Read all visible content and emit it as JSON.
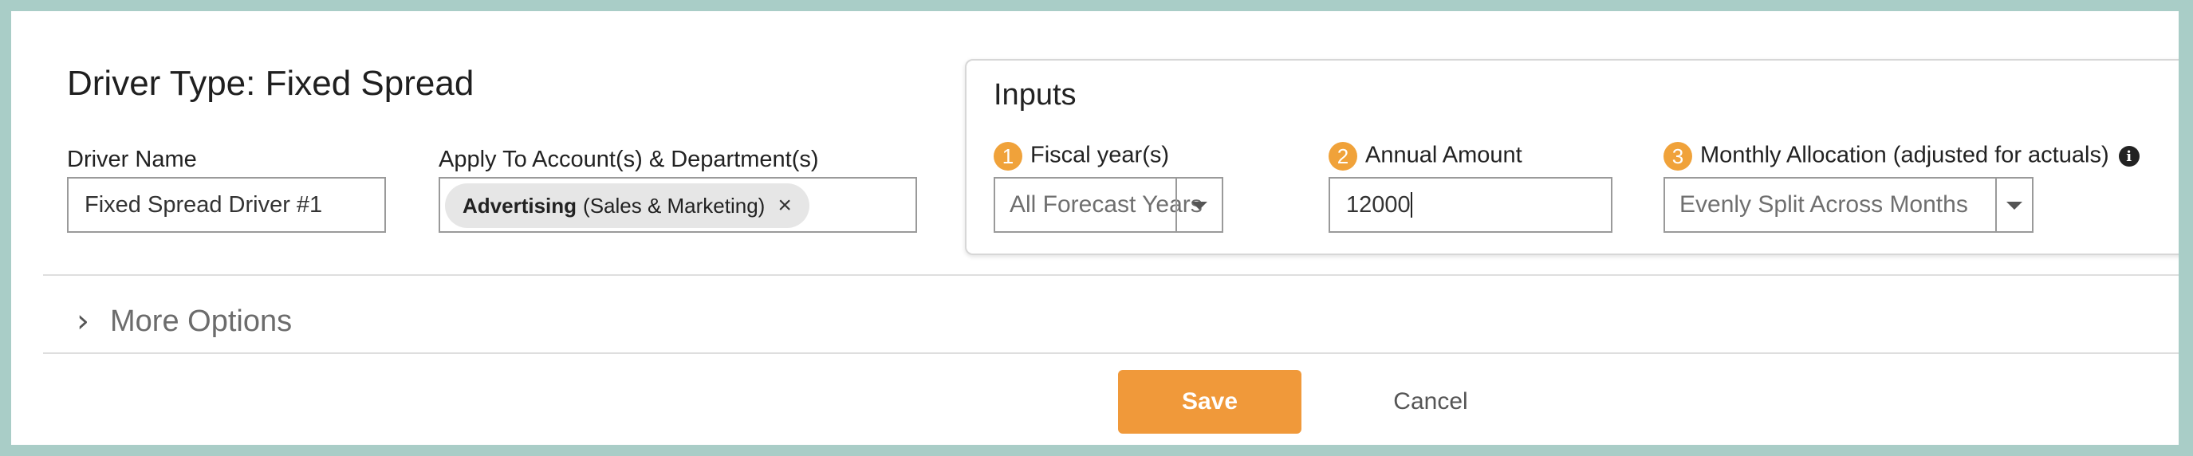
{
  "header": {
    "title": "Driver Type: Fixed Spread"
  },
  "driver_name": {
    "label": "Driver Name",
    "value": "Fixed Spread Driver #1"
  },
  "apply_to": {
    "label": "Apply To Account(s) & Department(s)",
    "chip": {
      "account": "Advertising",
      "department": "(Sales & Marketing)",
      "remove_symbol": "×"
    }
  },
  "inputs": {
    "title": "Inputs",
    "fiscal_year": {
      "step": "1",
      "label": "Fiscal year(s)",
      "value": "All Forecast Years"
    },
    "annual_amount": {
      "step": "2",
      "label": "Annual Amount",
      "value": "12000"
    },
    "monthly_allocation": {
      "step": "3",
      "label": "Monthly Allocation (adjusted for actuals)",
      "value": "Evenly Split Across Months",
      "info_symbol": "i"
    }
  },
  "more_options": {
    "label": "More Options"
  },
  "footer": {
    "save_label": "Save",
    "cancel_label": "Cancel"
  },
  "colors": {
    "accent": "#f0993a",
    "frame_border": "#a9cdc7"
  }
}
